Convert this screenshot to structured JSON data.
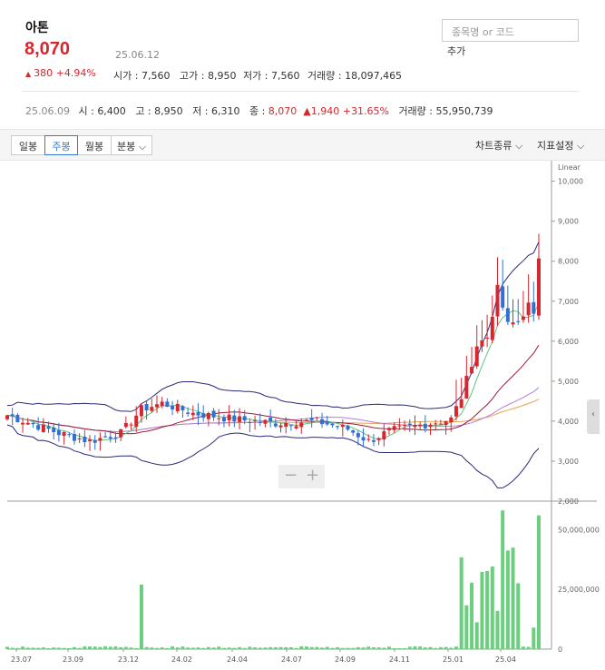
{
  "stock": {
    "name": "아톤",
    "price": "8,070",
    "date": "25.06.12",
    "change": "380",
    "change_pct": "+4.94%"
  },
  "stats": [
    {
      "label": "시가",
      "value": "7,560"
    },
    {
      "label": "고가",
      "value": "8,950"
    },
    {
      "label": "저가",
      "value": "7,560"
    },
    {
      "label": "거래량",
      "value": "18,097,465"
    }
  ],
  "search": {
    "placeholder": "종목명 or 코드",
    "add_label": "추가"
  },
  "week_bar": {
    "date": "25.06.09",
    "open_label": "시",
    "open": "6,400",
    "high_label": "고",
    "high": "8,950",
    "low_label": "저",
    "low": "6,310",
    "close_label": "종",
    "close": "8,070",
    "change": "1,940",
    "change_pct": "+31.65%",
    "vol_label": "거래량",
    "volume": "55,950,739"
  },
  "toolbar": {
    "daily": "일봉",
    "weekly": "주봉",
    "monthly": "월봉",
    "minute": "분봉",
    "chart_type": "차트종류",
    "indicator": "지표설정"
  },
  "colors": {
    "up": "#d8262e",
    "down": "#2f6fd6",
    "volume": "#6ccf7f",
    "accent": "#2f7ad8"
  },
  "chart_data": {
    "type": "candlestick",
    "scale_label": "Linear",
    "price_ticks": [
      "10,000",
      "9,000",
      "8,000",
      "7,000",
      "6,000",
      "5,000",
      "4,000",
      "3,000",
      "2,000"
    ],
    "volume_ticks": [
      "50,000,000",
      "25,000,000",
      "0"
    ],
    "x_labels": [
      "23.07",
      "23.09",
      "23.12",
      "24.02",
      "24.04",
      "24.07",
      "24.09",
      "24.11",
      "25.01",
      "25.04"
    ],
    "ylim": [
      2000,
      10400
    ],
    "volume_max": 60000000
  }
}
